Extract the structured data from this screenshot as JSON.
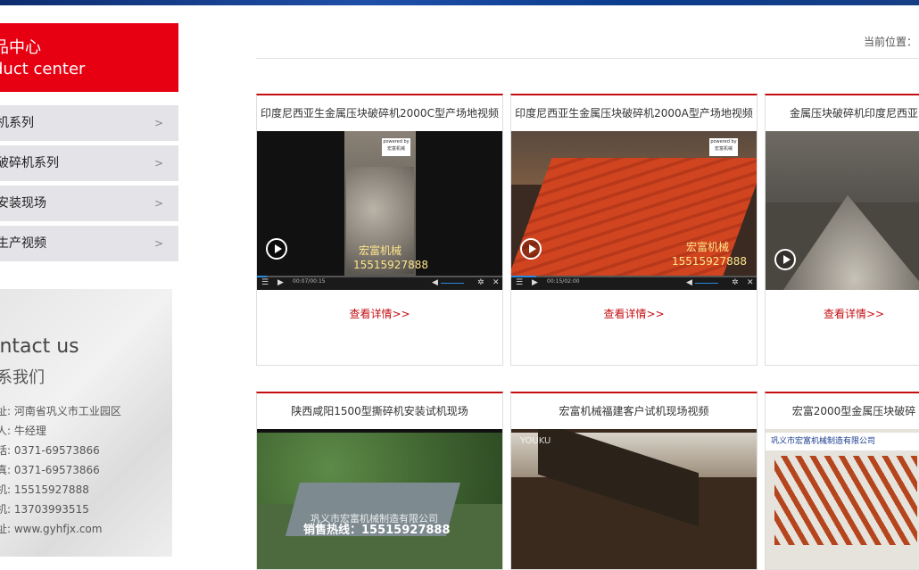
{
  "sidebar": {
    "category_cn": "品中心",
    "category_en": "duct center",
    "items": [
      {
        "label": "机系列",
        "arrow": ">"
      },
      {
        "label": "破碎机系列",
        "arrow": ">"
      },
      {
        "label": "安装现场",
        "arrow": ">"
      },
      {
        "label": "生产视频",
        "arrow": ">"
      }
    ],
    "contact": {
      "title_en": "ontact us",
      "title_cn": "系我们",
      "lines": [
        "址: 河南省巩义市工业园区",
        "人: 牛经理",
        "话: 0371-69573866",
        "真: 0371-69573866",
        "机: 15515927888",
        "机: 13703993515",
        "址: www.gyhfjx.com"
      ]
    }
  },
  "breadcrumb": "当前位置：",
  "more_label": "查看详情>>",
  "videos": [
    {
      "title": "印度尼西亚生金属压块破碎机2000C型产场地视频",
      "time": "00:07/00:15",
      "watermark": "宏富机械 15515927888",
      "logo": "powered by 宏富机械"
    },
    {
      "title": "印度尼西亚生金属压块破碎机2000A型产场地视频",
      "time": "00:15/02:00",
      "watermark": "宏富机械 15515927888",
      "logo": "powered by 宏富机械"
    },
    {
      "title": "金属压块破碎机印度尼西亚",
      "time": "",
      "watermark": "",
      "logo": ""
    },
    {
      "title": "陕西咸阳1500型撕碎机安装试机现场",
      "watermark": "销售热线：15515927888",
      "logo": "巩义市宏富机械制造有限公司"
    },
    {
      "title": "宏富机械福建客户试机现场视频",
      "watermark": "",
      "logo": "YOUKU"
    },
    {
      "title": "宏富2000型金属压块破碎",
      "watermark": "",
      "logo": "巩义市宏富机械制造有限公司"
    }
  ],
  "colors": {
    "accent": "#e60012",
    "link": "#c40e12"
  }
}
